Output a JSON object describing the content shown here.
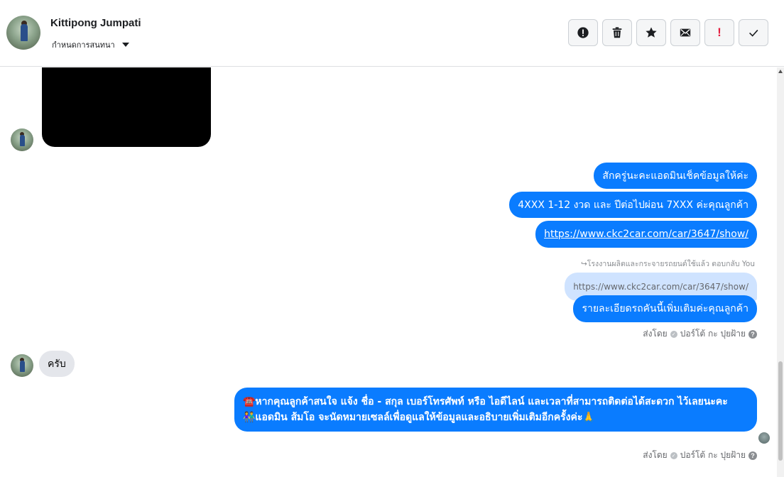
{
  "header": {
    "contact_name": "Kittipong Jumpati",
    "assign_label": "กำหนดการสนทนา",
    "actions": {
      "spam": "alert-circle-icon",
      "delete": "trash-icon",
      "star": "star-icon",
      "mark_unread": "envelope-icon",
      "important": "!",
      "done": "check-icon"
    }
  },
  "messages": {
    "out_1": "สักครู่นะคะแอดมินเช็คข้อมูลให้ค่ะ",
    "out_2": "4XXX  1-12  งวด และ ปีต่อไปผ่อน 7XXX  ค่ะคุณลูกค้า",
    "out_3_link": "https://www.ckc2car.com/car/3647/show/",
    "reply_note": "โรงงานผลิตและกระจายรถยนต์ใช้แล้ว ตอบกลับ You",
    "reply_quote": "https://www.ckc2car.com/car/3647/show/",
    "out_4": "รายละเอียดรถคันนี้เพิ่มเติมค่ะคุณลูกค้า",
    "sent_by_1": "ส่งโดย",
    "sent_by_1_name": "ปอร์โต้ กะ ปุยฝ้าย",
    "in_1": "ครับ",
    "out_5_line1": "☎️หากคุณลูกค้าสนใจ แจ้ง ชื่อ - สกุล เบอร์โทรศัพท์ หรือ ไอดีไลน์ และเวลาที่สามารถติดต่อได้สะดวก ไว้เลยนะคะ",
    "out_5_line2": "👫แอดมิน ส้มโอ จะนัดหมายเซลล์เพื่อดูแลให้ข้อมูลและอธิบายเพิ่มเติมอีกครั้งค่ะ🙏",
    "sent_by_2": "ส่งโดย",
    "sent_by_2_name": "ปอร์โต้ กะ ปุยฝ้าย"
  },
  "colors": {
    "outgoing_bubble": "#0a7cff",
    "incoming_bubble": "#e4e6eb",
    "reply_bubble": "#cfe3ff",
    "important_red": "#e41e3f"
  }
}
